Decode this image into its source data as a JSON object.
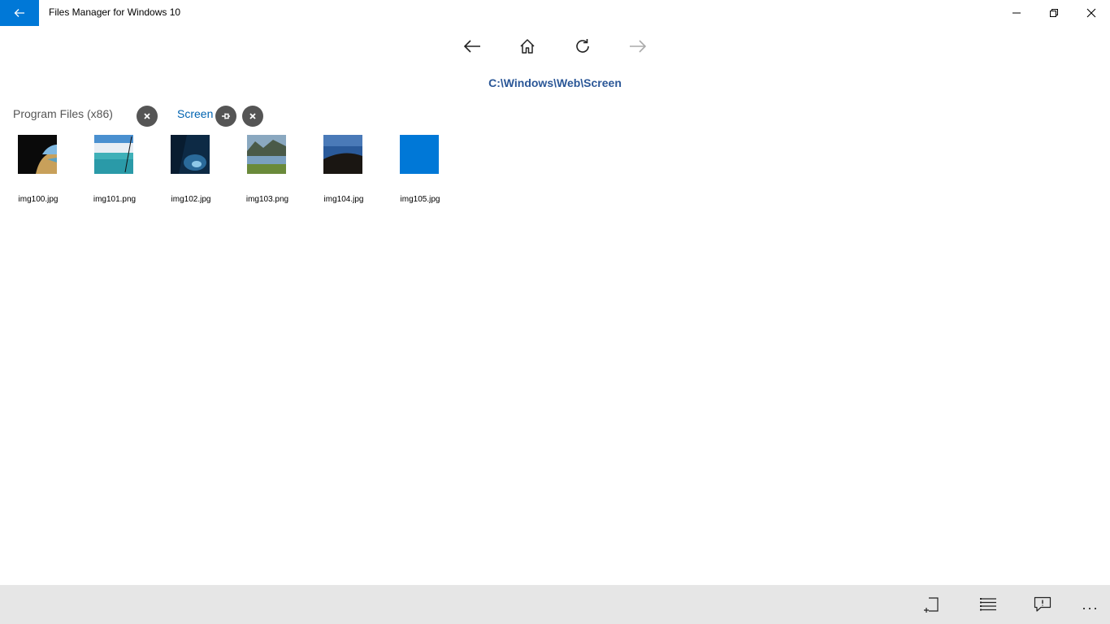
{
  "window": {
    "title": "Files Manager for Windows 10",
    "accent": "#0078d7"
  },
  "icons": {
    "back": "arrow-left-icon",
    "minimize": "minimize-icon",
    "maximize": "restore-icon",
    "close": "close-icon",
    "nav_back": "arrow-left-icon",
    "home": "home-icon",
    "refresh": "refresh-icon",
    "nav_forward": "arrow-right-icon",
    "new_folder": "new-folder-icon",
    "list_view": "list-view-icon",
    "feedback": "feedback-icon",
    "more": "more-icon"
  },
  "path": "C:\\Windows\\Web\\Screen",
  "breadcrumbs": [
    {
      "label": "Program Files (x86)",
      "active": false
    },
    {
      "label": "Screen",
      "active": true
    }
  ],
  "files": [
    {
      "name": "img100.jpg"
    },
    {
      "name": "img101.png"
    },
    {
      "name": "img102.jpg"
    },
    {
      "name": "img103.png"
    },
    {
      "name": "img104.jpg"
    },
    {
      "name": "img105.jpg"
    }
  ],
  "bottom_bar": {
    "more_label": "..."
  }
}
